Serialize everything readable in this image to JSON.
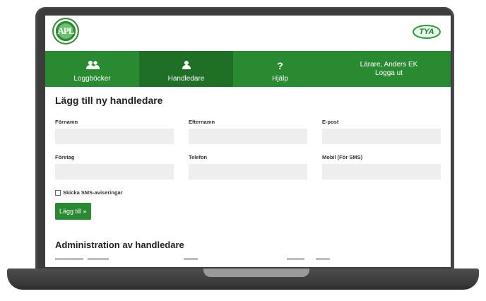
{
  "logos": {
    "left_text": "APL",
    "right_text": "TYA"
  },
  "colors": {
    "brand_green": "#2a8a32",
    "active_nav": "#1f6f27",
    "input_bg": "#eeeeee"
  },
  "nav": {
    "items": [
      {
        "label": "Loggböcker",
        "icon": "users-icon"
      },
      {
        "label": "Handledare",
        "icon": "user-icon",
        "active": true
      },
      {
        "label": "Hjälp",
        "icon": "help-icon"
      }
    ],
    "user": {
      "name": "Lärare, Anders EK",
      "logout": "Logga ut"
    }
  },
  "form": {
    "title": "Lägg till ny handledare",
    "fields": {
      "fornamn": {
        "label": "Förnamn",
        "value": ""
      },
      "efternamn": {
        "label": "Efternamn",
        "value": ""
      },
      "epost": {
        "label": "E-post",
        "value": ""
      },
      "foretag": {
        "label": "Företag",
        "value": ""
      },
      "telefon": {
        "label": "Telefon",
        "value": ""
      },
      "mobil": {
        "label": "Mobil (För SMS)",
        "value": ""
      }
    },
    "sms_checkbox": {
      "label": "Skicka SMS-aviseringar",
      "checked": false
    },
    "submit_label": "Lägg till »"
  },
  "admin": {
    "title": "Administration av handledare"
  }
}
